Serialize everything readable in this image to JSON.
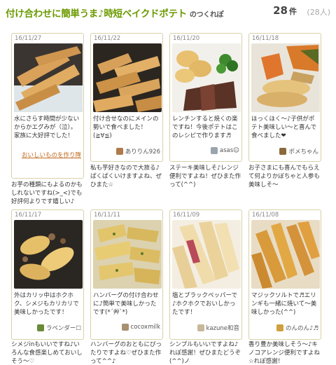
{
  "header": {
    "title": "付け合わせに簡単うま♪時短ベイクドポテト",
    "suffix": "のつくれぽ",
    "count": "28",
    "count_unit": "件",
    "people": "(28人)"
  },
  "cards": [
    {
      "date": "16/11/27",
      "text": "水にさらす時間が少ないからかエグみが（泣）。家族に大好評でした！",
      "user": "おいしいものを作り隊",
      "below": "お芋の種類にもよるのかもしれないですね(>_<)でも好評何よりです嬉しい♪"
    },
    {
      "date": "16/11/22",
      "text": "付け合せなのにメインの勢いで食べました！(≧∀≦)",
      "user": "ありりん926",
      "below": "私も芋好きなので大旅る♪ぱくぱくいけますよね、ぜひまた☆"
    },
    {
      "date": "16/11/20",
      "text": "レンチンすると焼くの楽ですね！今後ポテトはこのレシピで作ります♬",
      "user": "asas☺",
      "below": "ステーキ美味しそ♪レンジ便利ですよね！ぜひまた作って(^^)"
    },
    {
      "date": "16/11/18",
      "text": "ほっくほく～♪子供がポテト美味しい～と喜んで食べました❤",
      "user": "ポメちゃん",
      "below": "お子さまにも喜んでもらえて何よりかぼちゃと人参も美味しそ～"
    },
    {
      "date": "16/11/17",
      "text": "外はカリッ中はホクホク、シメジもカリカリで美味しかったです！",
      "user": "ラベンダー☐",
      "below": "シメジinもいいですね♪いろんな食感楽しめておいしそう～♡"
    },
    {
      "date": "16/11/11",
      "text": "ハンバーグの付け合わせに♪簡単で美味しかったです(*´艸`*)",
      "user": "cocoxmilk",
      "below": "ハンバーグのおともにぴったりですよね♡ぜひまた作って^^♪"
    },
    {
      "date": "16/11/09",
      "text": "塩とブラックペッパーで♪ホクホクでおいしかったです！",
      "user": "kazune和音",
      "below": "シンプルもいいですよね♪れぽ感謝！ぜひまたどうぞ(^^)ノ"
    },
    {
      "date": "16/11/08",
      "text": "マジックソルトで♬エリンギも一緒に焼いて〜美味しかった(^^)",
      "user": "のんのん♪♬",
      "below": "香り豊か美味しそう～♪キノコアレンジ便利ですよね☆れぽ感謝！"
    }
  ],
  "colors": {
    "title_green": "#6b9a00",
    "card_border": "#d9d0a8",
    "link_orange": "#c0671a"
  }
}
